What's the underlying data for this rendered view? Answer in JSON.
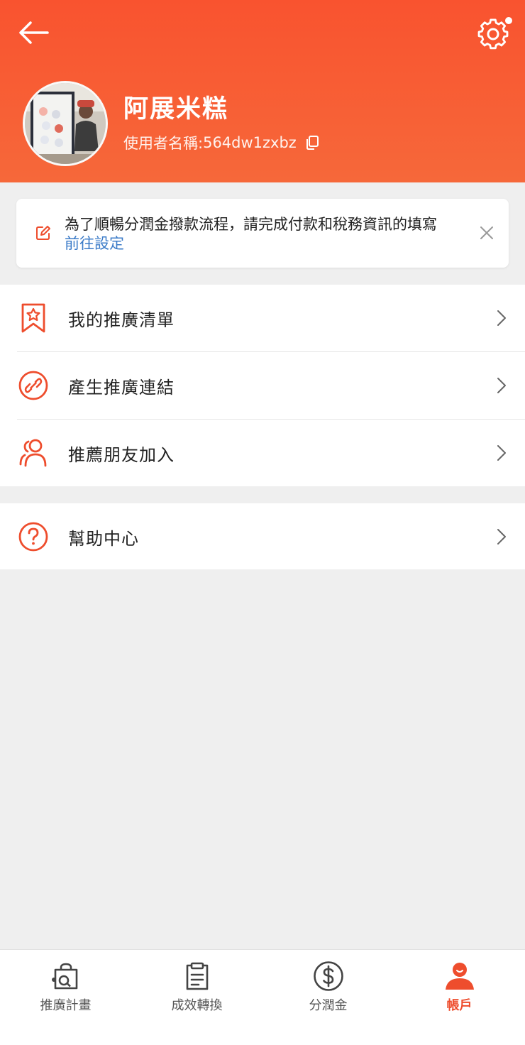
{
  "header": {
    "display_name": "阿展米糕",
    "username_label": "使用者名稱: ",
    "username": "564dw1zxbz"
  },
  "notice": {
    "message": "為了順暢分潤金撥款流程，請完成付款和稅務資訊的填寫",
    "link_label": "前往設定"
  },
  "menu": {
    "group1": [
      {
        "label": "我的推廣清單",
        "icon": "bookmark-star-icon"
      },
      {
        "label": "產生推廣連結",
        "icon": "link-icon"
      },
      {
        "label": "推薦朋友加入",
        "icon": "users-icon"
      }
    ],
    "group2": [
      {
        "label": "幫助中心",
        "icon": "help-icon"
      }
    ]
  },
  "tabs": [
    {
      "label": "推廣計畫",
      "icon": "campaign-bag-icon",
      "active": false
    },
    {
      "label": "成效轉換",
      "icon": "clipboard-icon",
      "active": false
    },
    {
      "label": "分潤金",
      "icon": "dollar-coin-icon",
      "active": false
    },
    {
      "label": "帳戶",
      "icon": "account-person-icon",
      "active": true
    }
  ],
  "colors": {
    "brand": "#ee4d2d",
    "header_gradient_top": "#f9532f",
    "header_gradient_bottom": "#f6683a",
    "link": "#3b7bc8"
  }
}
